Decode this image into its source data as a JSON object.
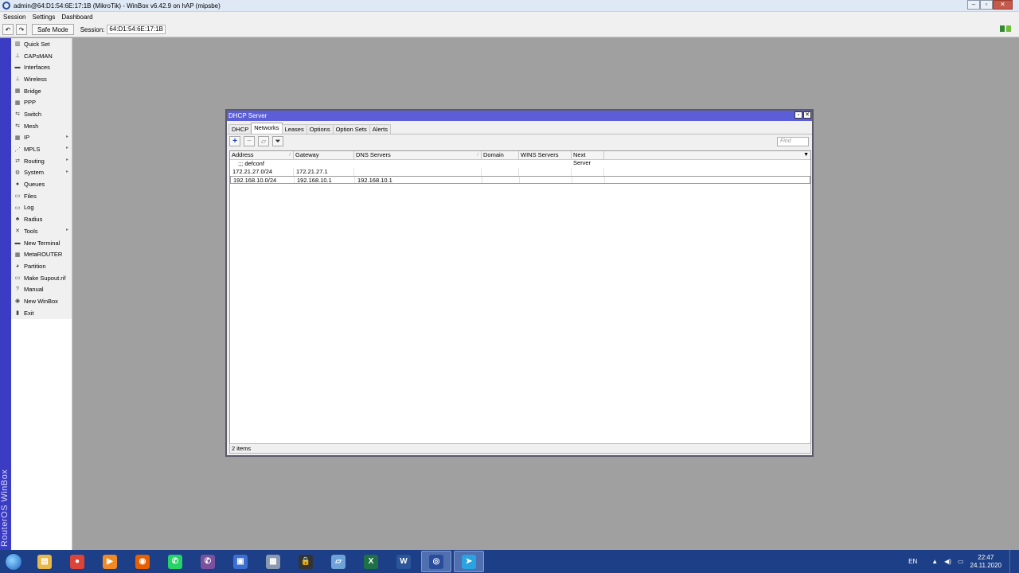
{
  "window": {
    "title": "admin@64:D1:54:6E:17:1B (MikroTik) - WinBox v6.42.9 on hAP (mipsbe)"
  },
  "menubar": [
    "Session",
    "Settings",
    "Dashboard"
  ],
  "toolbar": {
    "safe_mode": "Safe Mode",
    "session_label": "Session:",
    "session_value": "64:D1:54:6E:17:1B"
  },
  "brand": "RouterOS WinBox",
  "sidebar": {
    "items": [
      {
        "label": "Quick Set",
        "icon": "quickset-icon",
        "submenu": false
      },
      {
        "label": "CAPsMAN",
        "icon": "capsman-icon",
        "submenu": false
      },
      {
        "label": "Interfaces",
        "icon": "interfaces-icon",
        "submenu": false
      },
      {
        "label": "Wireless",
        "icon": "wireless-icon",
        "submenu": false
      },
      {
        "label": "Bridge",
        "icon": "bridge-icon",
        "submenu": false
      },
      {
        "label": "PPP",
        "icon": "ppp-icon",
        "submenu": false
      },
      {
        "label": "Switch",
        "icon": "switch-icon",
        "submenu": false
      },
      {
        "label": "Mesh",
        "icon": "mesh-icon",
        "submenu": false
      },
      {
        "label": "IP",
        "icon": "ip-icon",
        "submenu": true
      },
      {
        "label": "MPLS",
        "icon": "mpls-icon",
        "submenu": true
      },
      {
        "label": "Routing",
        "icon": "routing-icon",
        "submenu": true
      },
      {
        "label": "System",
        "icon": "system-icon",
        "submenu": true
      },
      {
        "label": "Queues",
        "icon": "queues-icon",
        "submenu": false
      },
      {
        "label": "Files",
        "icon": "files-icon",
        "submenu": false
      },
      {
        "label": "Log",
        "icon": "log-icon",
        "submenu": false
      },
      {
        "label": "Radius",
        "icon": "radius-icon",
        "submenu": false
      },
      {
        "label": "Tools",
        "icon": "tools-icon",
        "submenu": true
      },
      {
        "label": "New Terminal",
        "icon": "terminal-icon",
        "submenu": false
      },
      {
        "label": "MetaROUTER",
        "icon": "metarouter-icon",
        "submenu": false
      },
      {
        "label": "Partition",
        "icon": "partition-icon",
        "submenu": false
      },
      {
        "label": "Make Supout.rif",
        "icon": "supout-icon",
        "submenu": false
      },
      {
        "label": "Manual",
        "icon": "manual-icon",
        "submenu": false
      },
      {
        "label": "New WinBox",
        "icon": "winbox-icon",
        "submenu": false
      },
      {
        "label": "Exit",
        "icon": "exit-icon",
        "submenu": false
      }
    ]
  },
  "dhcp_window": {
    "title": "DHCP Server",
    "tabs": [
      "DHCP",
      "Networks",
      "Leases",
      "Options",
      "Option Sets",
      "Alerts"
    ],
    "active_tab": "Networks",
    "find_placeholder": "Find",
    "columns": [
      "Address",
      "Gateway",
      "DNS Servers",
      "Domain",
      "WINS Servers",
      "Next Server"
    ],
    "comment": ";;; defconf",
    "rows": [
      {
        "address": "172.21.27.0/24",
        "gateway": "172.21.27.1",
        "dns": "",
        "domain": "",
        "wins": "",
        "next": ""
      },
      {
        "address": "192.168.10.0/24",
        "gateway": "192.168.10.1",
        "dns": "192.168.10.1",
        "domain": "",
        "wins": "",
        "next": ""
      }
    ],
    "status": "2 items"
  },
  "taskbar": {
    "apps": [
      {
        "name": "explorer-icon",
        "color": "#e8b84a",
        "glyph": "▤"
      },
      {
        "name": "chrome-icon",
        "color": "#db4437",
        "glyph": "●"
      },
      {
        "name": "media-player-icon",
        "color": "#f08a24",
        "glyph": "▶"
      },
      {
        "name": "firefox-icon",
        "color": "#e66000",
        "glyph": "◉"
      },
      {
        "name": "whatsapp-icon",
        "color": "#25d366",
        "glyph": "✆"
      },
      {
        "name": "viber-icon",
        "color": "#7b519d",
        "glyph": "✆"
      },
      {
        "name": "network-tool-icon",
        "color": "#3d6fd1",
        "glyph": "▣"
      },
      {
        "name": "calculator-icon",
        "color": "#8a9bb0",
        "glyph": "▦"
      },
      {
        "name": "lock-app-icon",
        "color": "#333333",
        "glyph": "🔒"
      },
      {
        "name": "notes-icon",
        "color": "#6fa3d8",
        "glyph": "▱"
      },
      {
        "name": "excel-icon",
        "color": "#1e7145",
        "glyph": "X"
      },
      {
        "name": "word-icon",
        "color": "#2b579a",
        "glyph": "W"
      },
      {
        "name": "winbox-taskbar-icon",
        "color": "#2a4d9b",
        "glyph": "◎"
      },
      {
        "name": "telegram-icon",
        "color": "#2aa3e0",
        "glyph": "➤"
      }
    ],
    "active_apps": [
      "winbox-taskbar-icon",
      "telegram-icon"
    ],
    "language": "EN",
    "time": "22:47",
    "date": "24.11.2020"
  }
}
